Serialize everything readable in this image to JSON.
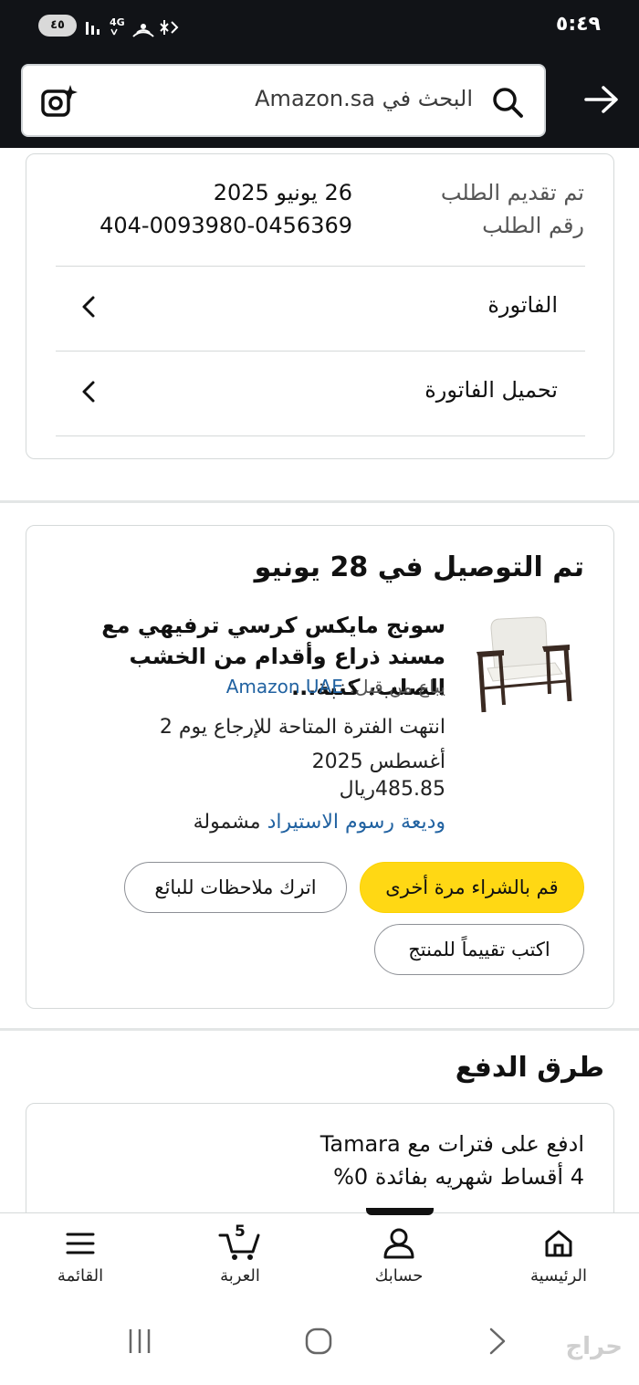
{
  "status_bar": {
    "time": "٥:٤٩",
    "battery": "٤٥",
    "network": "4G"
  },
  "search": {
    "placeholder": "البحث في Amazon.sa"
  },
  "order": {
    "placed_label": "تم تقديم الطلب",
    "placed_value": "26 يونيو 2025",
    "number_label": "رقم الطلب",
    "number_value": "404-0093980-0456369",
    "invoice": "الفاتورة",
    "download_invoice": "تحميل الفاتورة"
  },
  "delivery": {
    "title": "تم التوصيل في 28 يونيو",
    "product_title": "سونج مايكس كرسي ترفيهي مع مسند ذراع وأقدام من الخشب الصلب، كنبة...",
    "sold_by_label": "يباع من قبل:",
    "sold_by_value": "Amazon UAE",
    "return_note": "انتهت الفترة المتاحة للإرجاع يوم 2 أغسطس 2025",
    "price": "485.85ريال",
    "deposit_link": "وديعة رسوم الاستيراد",
    "deposit_suffix": "مشمولة",
    "buy_again": "قم بالشراء مرة أخرى",
    "leave_feedback": "اترك ملاحظات للبائع",
    "write_review": "اكتب تقييماً للمنتج"
  },
  "payment": {
    "title": "طرق الدفع",
    "line1": "ادفع على فترات مع Tamara",
    "line2": "4 أقساط شهريه بفائدة 0%"
  },
  "bottom_nav": {
    "home": "الرئيسية",
    "account": "حسابك",
    "cart": "العربة",
    "cart_count": "5",
    "menu": "القائمة"
  },
  "watermark": "حراج",
  "colors": {
    "header_bg": "#111317",
    "button_yellow": "#ffd814",
    "link_blue": "#2162a1"
  }
}
